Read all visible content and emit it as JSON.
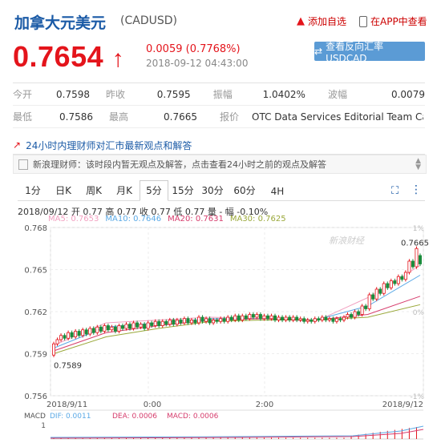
{
  "header": {
    "title": "加拿大元美元",
    "code": "(CADUSD)",
    "add_watch": "添加自选",
    "app_view": "在APP中查看"
  },
  "quote": {
    "price": "0.7654",
    "arrow": "↑",
    "change": "0.0059 (0.7768%)",
    "time": "2018-09-12 04:43:00",
    "reverse_button": "查看反向汇率 USDCAD"
  },
  "stats": [
    [
      {
        "label": "今开",
        "value": "0.7598"
      },
      {
        "label": "昨收",
        "value": "0.7595"
      },
      {
        "label": "振幅",
        "value": "1.0402%"
      },
      {
        "label": "波幅",
        "value": "0.0079"
      }
    ],
    [
      {
        "label": "最低",
        "value": "0.7586"
      },
      {
        "label": "最高",
        "value": "0.7665"
      },
      {
        "label": "报价",
        "value": "OTC Data Services Editorial Team Calc..."
      }
    ]
  ],
  "news": {
    "heading": "24小时内理财师对汇市最新观点和解答",
    "item": "新浪理财师：该时段内暂无观点及解答，点击查看24小时之前的观点及解答"
  },
  "tabs": [
    "1分",
    "日K",
    "周K",
    "月K",
    "5分",
    "15分",
    "30分",
    "60分",
    "4H"
  ],
  "active_tab": 4,
  "bar_info": "2018/09/12  开 0.77  高 0.77  收 0.77  低 0.77  量 -  幅 -0.10%",
  "ma": [
    {
      "text": "MA5: 0.7653",
      "color": "#f2a0c0"
    },
    {
      "text": "MA10: 0.7646",
      "color": "#5aa9e6"
    },
    {
      "text": "MA20: 0.7631",
      "color": "#d63c6c"
    },
    {
      "text": "MA30: 0.7625",
      "color": "#9aa83a"
    }
  ],
  "macd": {
    "label": "MACD",
    "dif": "DIF: 0.0011",
    "dea": "DEA: 0.0006",
    "macd": "MACD: 0.0006",
    "axis_top": "1"
  },
  "watermark": "新浪财经",
  "chart_data": {
    "type": "candlestick",
    "y_ticks": [
      "0.768",
      "0.765",
      "0.762",
      "0.759",
      "0.756"
    ],
    "pct_ticks": [
      "1%",
      "",
      "0%",
      "",
      "-1%"
    ],
    "x_labels": [
      "2018/9/11",
      "0:00",
      "2:00",
      "2018/9/12"
    ],
    "ylim": [
      0.756,
      0.768
    ],
    "annotations": [
      {
        "text": "0.7665"
      },
      {
        "text": "0.7589"
      }
    ],
    "candles": [
      [
        0.7589,
        0.7597
      ],
      [
        0.7597,
        0.76
      ],
      [
        0.76,
        0.7603
      ],
      [
        0.7603,
        0.7601
      ],
      [
        0.7601,
        0.7605
      ],
      [
        0.7605,
        0.7602
      ],
      [
        0.7602,
        0.7606
      ],
      [
        0.7606,
        0.7603
      ],
      [
        0.7603,
        0.7607
      ],
      [
        0.7607,
        0.7604
      ],
      [
        0.7604,
        0.7608
      ],
      [
        0.7608,
        0.7605
      ],
      [
        0.7605,
        0.7609
      ],
      [
        0.7609,
        0.7606
      ],
      [
        0.7606,
        0.761
      ],
      [
        0.761,
        0.7607
      ],
      [
        0.7607,
        0.7609
      ],
      [
        0.7609,
        0.7606
      ],
      [
        0.7606,
        0.761
      ],
      [
        0.761,
        0.7608
      ],
      [
        0.7608,
        0.7611
      ],
      [
        0.7611,
        0.7608
      ],
      [
        0.7608,
        0.7612
      ],
      [
        0.7612,
        0.7609
      ],
      [
        0.7609,
        0.7611
      ],
      [
        0.7611,
        0.7608
      ],
      [
        0.7608,
        0.7612
      ],
      [
        0.7612,
        0.761
      ],
      [
        0.761,
        0.7613
      ],
      [
        0.7613,
        0.761
      ],
      [
        0.761,
        0.7613
      ],
      [
        0.7613,
        0.7611
      ],
      [
        0.7611,
        0.7614
      ],
      [
        0.7614,
        0.7611
      ],
      [
        0.7611,
        0.7614
      ],
      [
        0.7614,
        0.7612
      ],
      [
        0.7612,
        0.7615
      ],
      [
        0.7615,
        0.7612
      ],
      [
        0.7612,
        0.7614
      ],
      [
        0.7614,
        0.7612
      ],
      [
        0.7612,
        0.7616
      ],
      [
        0.7616,
        0.7613
      ],
      [
        0.7613,
        0.7615
      ],
      [
        0.7615,
        0.7612
      ],
      [
        0.7612,
        0.7614
      ],
      [
        0.7614,
        0.7613
      ],
      [
        0.7613,
        0.7615
      ],
      [
        0.7615,
        0.7613
      ],
      [
        0.7613,
        0.7616
      ],
      [
        0.7616,
        0.7614
      ],
      [
        0.7614,
        0.7617
      ],
      [
        0.7617,
        0.7614
      ],
      [
        0.7614,
        0.7617
      ],
      [
        0.7617,
        0.7615
      ],
      [
        0.7615,
        0.7618
      ],
      [
        0.7618,
        0.7616
      ],
      [
        0.7616,
        0.7618
      ],
      [
        0.7618,
        0.7615
      ],
      [
        0.7615,
        0.7617
      ],
      [
        0.7617,
        0.7615
      ],
      [
        0.7615,
        0.7617
      ],
      [
        0.7617,
        0.7614
      ],
      [
        0.7614,
        0.7616
      ],
      [
        0.7616,
        0.7614
      ],
      [
        0.7614,
        0.7616
      ],
      [
        0.7616,
        0.7614
      ],
      [
        0.7614,
        0.7616
      ],
      [
        0.7616,
        0.7614
      ],
      [
        0.7614,
        0.7615
      ],
      [
        0.7615,
        0.7613
      ],
      [
        0.7613,
        0.7614
      ],
      [
        0.7614,
        0.7613
      ],
      [
        0.7613,
        0.7615
      ],
      [
        0.7615,
        0.7614
      ],
      [
        0.7614,
        0.7616
      ],
      [
        0.7616,
        0.7614
      ],
      [
        0.7614,
        0.7615
      ],
      [
        0.7615,
        0.7613
      ],
      [
        0.7613,
        0.7615
      ],
      [
        0.7615,
        0.7614
      ],
      [
        0.7614,
        0.7616
      ],
      [
        0.7616,
        0.7618
      ],
      [
        0.7618,
        0.7616
      ],
      [
        0.7616,
        0.762
      ],
      [
        0.762,
        0.7618
      ],
      [
        0.7618,
        0.7624
      ],
      [
        0.7624,
        0.7622
      ],
      [
        0.7622,
        0.7632
      ],
      [
        0.7632,
        0.7629
      ],
      [
        0.7629,
        0.7636
      ],
      [
        0.7636,
        0.7633
      ],
      [
        0.7633,
        0.764
      ],
      [
        0.764,
        0.7637
      ],
      [
        0.7637,
        0.7642
      ],
      [
        0.7642,
        0.764
      ],
      [
        0.764,
        0.7645
      ],
      [
        0.7645,
        0.7643
      ],
      [
        0.7643,
        0.7648
      ],
      [
        0.7648,
        0.7656
      ],
      [
        0.7656,
        0.7652
      ],
      [
        0.7652,
        0.7665
      ],
      [
        0.766,
        0.7654
      ]
    ],
    "ma_series": [
      {
        "name": "MA5",
        "color": "#f2a0c0",
        "values": [
          0.7596,
          0.7612,
          0.7614,
          0.7616,
          0.7615,
          0.7613,
          0.763,
          0.7653
        ]
      },
      {
        "name": "MA10",
        "color": "#5aa9e6",
        "values": [
          0.7594,
          0.7609,
          0.7612,
          0.7615,
          0.7615,
          0.7614,
          0.7624,
          0.7646
        ]
      },
      {
        "name": "MA20",
        "color": "#d63c6c",
        "values": [
          0.7592,
          0.7605,
          0.761,
          0.7614,
          0.7615,
          0.7614,
          0.7618,
          0.7631
        ]
      },
      {
        "name": "MA30",
        "color": "#9aa83a",
        "values": [
          0.759,
          0.7602,
          0.7608,
          0.7613,
          0.7614,
          0.7614,
          0.7616,
          0.7625
        ]
      }
    ]
  },
  "colors": {
    "up": "#e4141b",
    "down": "#1a8c3c",
    "blue": "#1a5aa6",
    "accent_btn": "#5b9bd5"
  }
}
